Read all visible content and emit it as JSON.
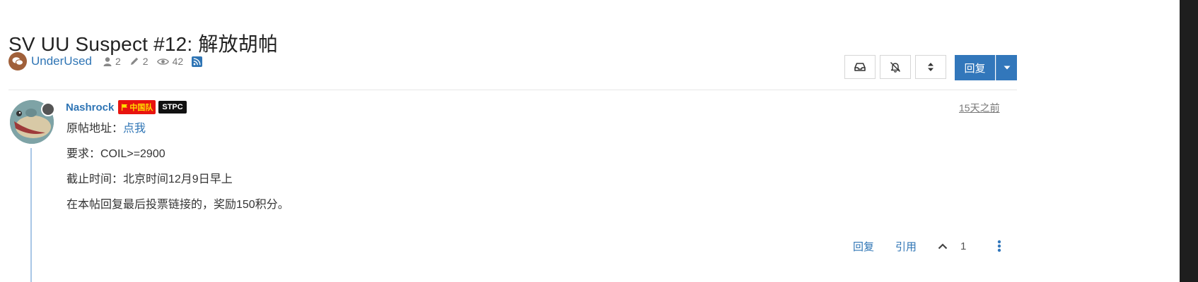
{
  "topic": {
    "title": "SV UU Suspect #12: 解放胡帕",
    "category": "UnderUsed",
    "posters_count": "2",
    "posts_count": "2",
    "views_count": "42"
  },
  "toolbar": {
    "reply_label": "回复"
  },
  "post": {
    "username": "Nashrock",
    "badge_team": "中国队",
    "badge_tag": "STPC",
    "timestamp": "15天之前",
    "line1_prefix": "原帖地址：",
    "line1_link": "点我",
    "line2": "要求：COIL>=2900",
    "line3": "截止时间：北京时间12月9日早上",
    "line4": "在本帖回复最后投票链接的，奖励150积分。",
    "actions": {
      "reply": "回复",
      "quote": "引用",
      "votes": "1"
    }
  },
  "colors": {
    "link": "#2f75b5",
    "primary_button": "#3277bb",
    "badge_cn_bg": "#e8140f",
    "badge_cn_text": "#ffdf00",
    "category_icon": "#a0603a",
    "thread_line": "#a9c7e6"
  },
  "icons": {
    "category": "comments-icon",
    "posters": "user-icon",
    "posts": "pencil-icon",
    "views": "eye-icon",
    "rss": "rss-icon",
    "tool_1": "inbox-icon",
    "tool_2": "bell-slash-icon",
    "tool_3": "sort-icon",
    "reply_dropdown": "caret-down-icon",
    "upvote": "chevron-up-icon",
    "more": "ellipsis-vertical-icon",
    "flag": "flag-icon"
  }
}
